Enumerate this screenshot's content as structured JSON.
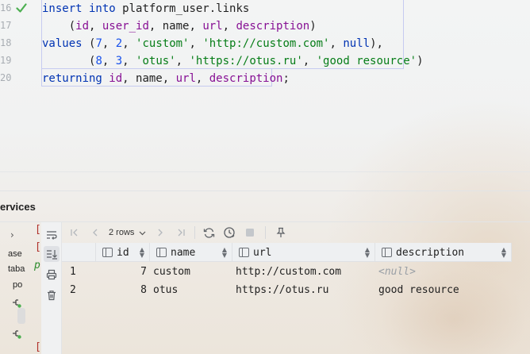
{
  "editor": {
    "line_numbers": [
      "16",
      "17",
      "18",
      "19",
      "20"
    ],
    "lines": [
      [
        {
          "t": "insert into ",
          "c": "kw"
        },
        {
          "t": "platform_user.links",
          "c": "plain"
        }
      ],
      [
        {
          "t": "    (",
          "c": "plain"
        },
        {
          "t": "id",
          "c": "col"
        },
        {
          "t": ", ",
          "c": "plain"
        },
        {
          "t": "user_id",
          "c": "col"
        },
        {
          "t": ", ",
          "c": "plain"
        },
        {
          "t": "name",
          "c": "plain"
        },
        {
          "t": ", ",
          "c": "plain"
        },
        {
          "t": "url",
          "c": "col"
        },
        {
          "t": ", ",
          "c": "plain"
        },
        {
          "t": "description",
          "c": "col"
        },
        {
          "t": ")",
          "c": "plain"
        }
      ],
      [
        {
          "t": "values ",
          "c": "kw"
        },
        {
          "t": "(",
          "c": "plain"
        },
        {
          "t": "7",
          "c": "num"
        },
        {
          "t": ", ",
          "c": "plain"
        },
        {
          "t": "2",
          "c": "num"
        },
        {
          "t": ", ",
          "c": "plain"
        },
        {
          "t": "'custom'",
          "c": "str"
        },
        {
          "t": ", ",
          "c": "plain"
        },
        {
          "t": "'http://custom.com'",
          "c": "str"
        },
        {
          "t": ", ",
          "c": "plain"
        },
        {
          "t": "null",
          "c": "kw"
        },
        {
          "t": "),",
          "c": "plain"
        }
      ],
      [
        {
          "t": "       (",
          "c": "plain"
        },
        {
          "t": "8",
          "c": "num"
        },
        {
          "t": ", ",
          "c": "plain"
        },
        {
          "t": "3",
          "c": "num"
        },
        {
          "t": ", ",
          "c": "plain"
        },
        {
          "t": "'otus'",
          "c": "str"
        },
        {
          "t": ", ",
          "c": "plain"
        },
        {
          "t": "'https://otus.ru'",
          "c": "str"
        },
        {
          "t": ", ",
          "c": "plain"
        },
        {
          "t": "'good resource'",
          "c": "str"
        },
        {
          "t": ")",
          "c": "plain"
        }
      ],
      [
        {
          "t": "returning ",
          "c": "kw"
        },
        {
          "t": "id",
          "c": "col"
        },
        {
          "t": ", ",
          "c": "plain"
        },
        {
          "t": "name",
          "c": "plain"
        },
        {
          "t": ", ",
          "c": "plain"
        },
        {
          "t": "url",
          "c": "col"
        },
        {
          "t": ", ",
          "c": "plain"
        },
        {
          "t": "description",
          "c": "col"
        },
        {
          "t": ";",
          "c": "plain"
        }
      ]
    ]
  },
  "services": {
    "title": "ervices",
    "tree_fragments": [
      "ase",
      "taba",
      "po"
    ],
    "log_marks": [
      "[",
      "[",
      "["
    ],
    "log_p": "p"
  },
  "result": {
    "rows_label": "2 rows",
    "columns": [
      "id",
      "name",
      "url",
      "description"
    ],
    "rows": [
      {
        "num": "1",
        "id": "7",
        "name": "custom",
        "url": "http://custom.com",
        "description": "<null>",
        "description_null": true
      },
      {
        "num": "2",
        "id": "8",
        "name": "otus",
        "url": "https://otus.ru",
        "description": "good resource",
        "description_null": false
      }
    ]
  },
  "colors": {
    "keyword": "#0033b3",
    "column": "#871094",
    "string": "#067d17",
    "number": "#1750eb",
    "check": "#4caf50",
    "log_mark": "#b0302a"
  },
  "icons": {
    "check": "check-icon",
    "soft_wrap": "soft-wrap-icon",
    "scroll_to_end": "scroll-to-end-icon",
    "print": "print-icon",
    "trash": "trash-icon",
    "first_page": "first-page-icon",
    "prev_page": "prev-page-icon",
    "next_page": "next-page-icon",
    "last_page": "last-page-icon",
    "reload": "reload-icon",
    "history": "history-icon",
    "stop": "stop-icon",
    "pin": "pin-icon"
  }
}
